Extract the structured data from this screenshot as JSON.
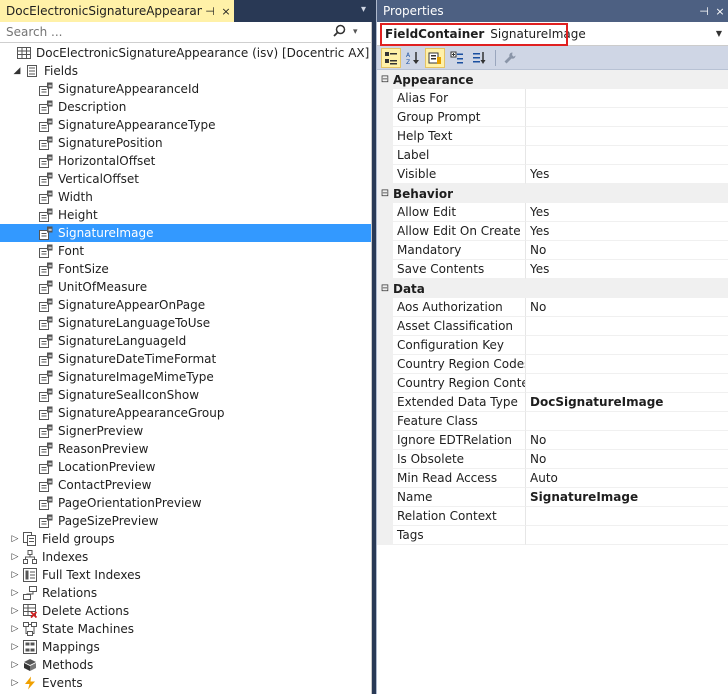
{
  "left_panel": {
    "tab_title": "DocElectronicSignatureAppearance",
    "pin_glyph": "⊣",
    "close_glyph": "×",
    "overflow_glyph": "▾",
    "search_placeholder": "Search ...",
    "root_label": "DocElectronicSignatureAppearance (isv) [Docentric AX]",
    "fields_label": "Fields",
    "fields": [
      "SignatureAppearanceId",
      "Description",
      "SignatureAppearanceType",
      "SignaturePosition",
      "HorizontalOffset",
      "VerticalOffset",
      "Width",
      "Height",
      "SignatureImage",
      "Font",
      "FontSize",
      "UnitOfMeasure",
      "SignatureAppearOnPage",
      "SignatureLanguageToUse",
      "SignatureLanguageId",
      "SignatureDateTimeFormat",
      "SignatureImageMimeType",
      "SignatureSealIconShow",
      "SignatureAppearanceGroup",
      "SignerPreview",
      "ReasonPreview",
      "LocationPreview",
      "ContactPreview",
      "PageOrientationPreview",
      "PageSizePreview"
    ],
    "selected_field": "SignatureImage",
    "groups": [
      {
        "label": "Field groups",
        "icon": "field-groups-icon"
      },
      {
        "label": "Indexes",
        "icon": "indexes-icon"
      },
      {
        "label": "Full Text Indexes",
        "icon": "full-text-indexes-icon"
      },
      {
        "label": "Relations",
        "icon": "relations-icon"
      },
      {
        "label": "Delete Actions",
        "icon": "delete-actions-icon"
      },
      {
        "label": "State Machines",
        "icon": "state-machines-icon"
      },
      {
        "label": "Mappings",
        "icon": "mappings-icon"
      },
      {
        "label": "Methods",
        "icon": "methods-icon"
      },
      {
        "label": "Events",
        "icon": "events-icon"
      }
    ]
  },
  "properties": {
    "title": "Properties",
    "pin_glyph": "⊣",
    "close_glyph": "×",
    "selector_type": "FieldContainer",
    "selector_name": "SignatureImage",
    "categories": [
      {
        "name": "Appearance",
        "rows": [
          {
            "name": "Alias For",
            "value": ""
          },
          {
            "name": "Group Prompt",
            "value": ""
          },
          {
            "name": "Help Text",
            "value": ""
          },
          {
            "name": "Label",
            "value": ""
          },
          {
            "name": "Visible",
            "value": "Yes"
          }
        ]
      },
      {
        "name": "Behavior",
        "rows": [
          {
            "name": "Allow Edit",
            "value": "Yes"
          },
          {
            "name": "Allow Edit On Create",
            "value": "Yes"
          },
          {
            "name": "Mandatory",
            "value": "No"
          },
          {
            "name": "Save Contents",
            "value": "Yes"
          }
        ]
      },
      {
        "name": "Data",
        "rows": [
          {
            "name": "Aos Authorization",
            "value": "No"
          },
          {
            "name": "Asset Classification",
            "value": ""
          },
          {
            "name": "Configuration Key",
            "value": ""
          },
          {
            "name": "Country Region Codes",
            "value": ""
          },
          {
            "name": "Country Region Context",
            "value": ""
          },
          {
            "name": "Extended Data Type",
            "value": "DocSignatureImage",
            "bold": true
          },
          {
            "name": "Feature Class",
            "value": ""
          },
          {
            "name": "Ignore EDTRelation",
            "value": "No"
          },
          {
            "name": "Is Obsolete",
            "value": "No"
          },
          {
            "name": "Min Read Access",
            "value": "Auto"
          },
          {
            "name": "Name",
            "value": "SignatureImage",
            "bold": true
          },
          {
            "name": "Relation Context",
            "value": ""
          },
          {
            "name": "Tags",
            "value": ""
          }
        ]
      }
    ]
  },
  "colors": {
    "selection": "#3399ff",
    "active_tab": "#fff1a8",
    "properties_title": "#4d6082",
    "highlight_border": "#e02020"
  }
}
